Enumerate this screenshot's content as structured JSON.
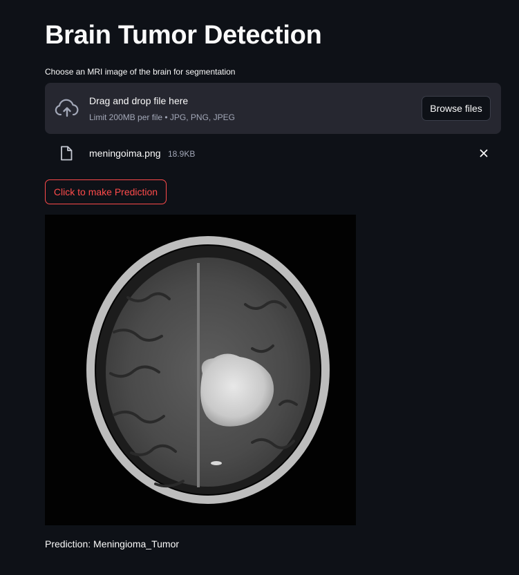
{
  "page": {
    "title": "Brain Tumor Detection"
  },
  "uploader": {
    "label": "Choose an MRI image of the brain for segmentation",
    "drop_instructions": "Drag and drop file here",
    "limits": "Limit 200MB per file • JPG, PNG, JPEG",
    "browse_label": "Browse files",
    "icon": "cloud-upload-icon"
  },
  "uploaded_file": {
    "name": "meningoima.png",
    "size": "18.9KB",
    "icon": "file-icon",
    "remove_icon": "close-icon"
  },
  "actions": {
    "predict_label": "Click to make Prediction"
  },
  "result": {
    "prediction_text": "Prediction: Meningioma_Tumor"
  },
  "colors": {
    "background": "#0e1117",
    "surface": "#262730",
    "text": "#fafafa",
    "muted": "#a3a8b8",
    "accent": "#ff4b4b"
  }
}
